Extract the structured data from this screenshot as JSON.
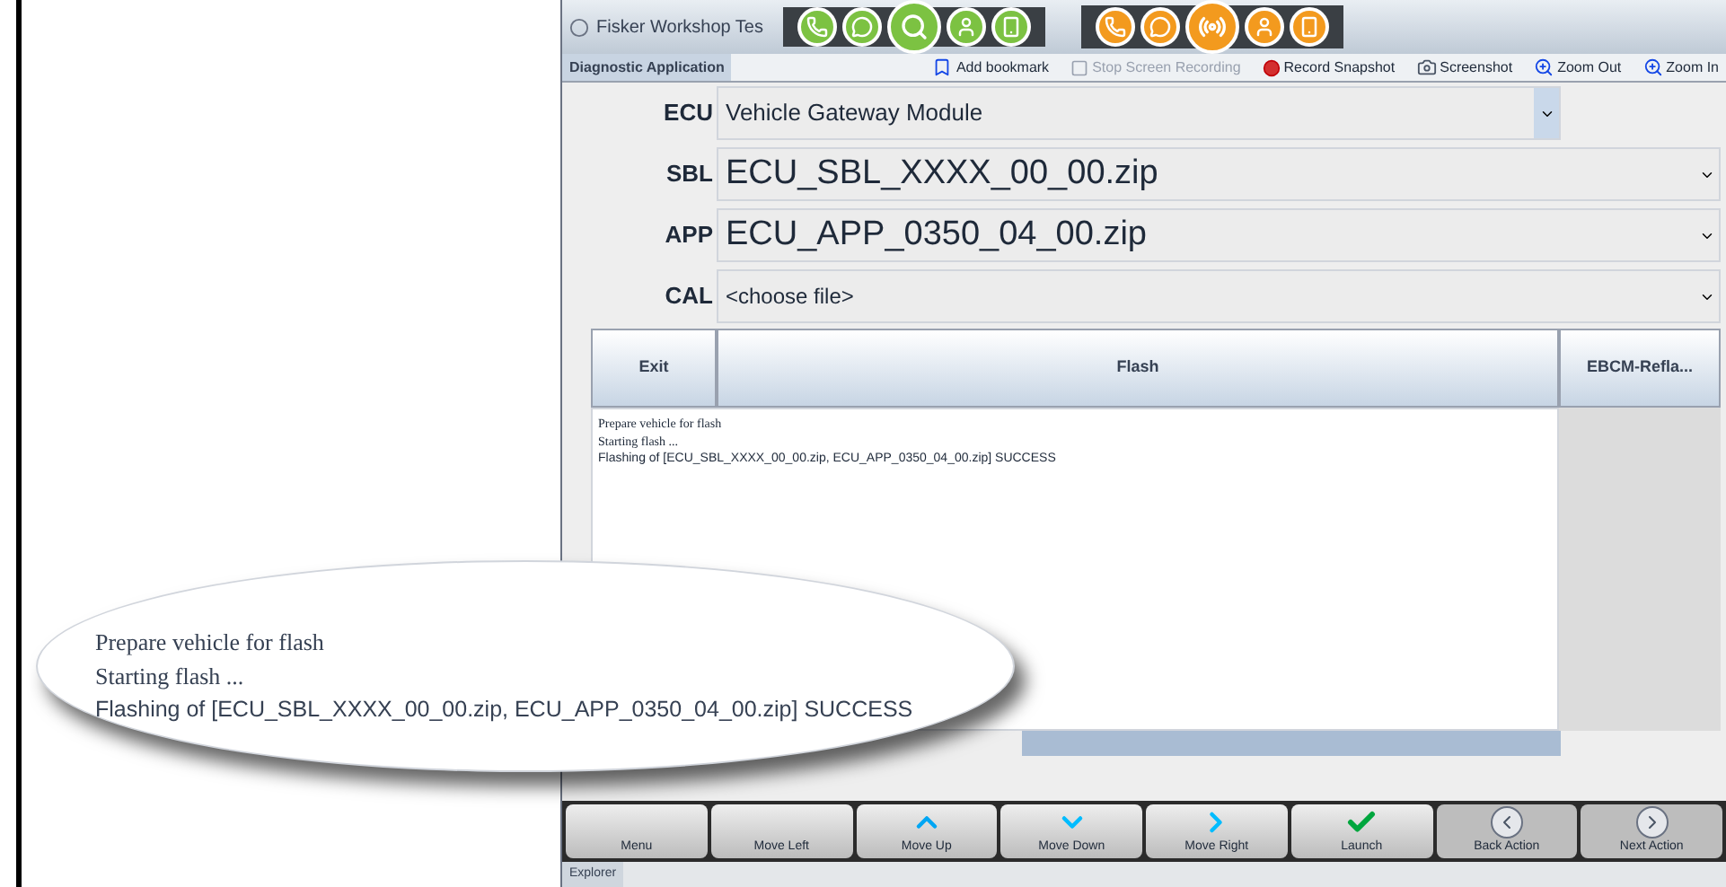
{
  "window": {
    "title": "Fisker Workshop Tes"
  },
  "toolbar": {
    "tab": "Diagnostic Application",
    "actions": [
      {
        "label": "Add bookmark",
        "kind": "bookmark",
        "disabled": false
      },
      {
        "label": "Stop Screen Recording",
        "kind": "stop",
        "disabled": true
      },
      {
        "label": "Record Snapshot",
        "kind": "record",
        "disabled": false
      },
      {
        "label": "Screenshot",
        "kind": "camera",
        "disabled": false
      },
      {
        "label": "Zoom Out",
        "kind": "zoom",
        "disabled": false
      },
      {
        "label": "Zoom In",
        "kind": "zoom",
        "disabled": false
      }
    ]
  },
  "form": {
    "fields": [
      {
        "label": "ECU",
        "value": "Vehicle Gateway Module",
        "kind": "select"
      },
      {
        "label": "SBL",
        "value": "ECU_SBL_XXXX_00_00.zip",
        "kind": "file"
      },
      {
        "label": "APP",
        "value": "ECU_APP_0350_04_00.zip",
        "kind": "file"
      },
      {
        "label": "CAL",
        "value": "<choose file>",
        "kind": "file_small"
      }
    ]
  },
  "buttons": [
    "Exit",
    "Flash",
    "EBCM-Refla..."
  ],
  "log": [
    "Prepare vehicle for flash",
    "Starting flash ...",
    "Flashing of [ECU_SBL_XXXX_00_00.zip, ECU_APP_0350_04_00.zip] SUCCESS"
  ],
  "magnifier": {
    "lines": [
      "Prepare vehicle for flash",
      "Starting flash ...",
      "Flashing of [ECU_SBL_XXXX_00_00.zip, ECU_APP_0350_04_00.zip] SUCCESS"
    ]
  },
  "nav_buttons": [
    {
      "label": "Menu",
      "kind": "none"
    },
    {
      "label": "Move Left",
      "kind": "none"
    },
    {
      "label": "Move Up",
      "kind": "up"
    },
    {
      "label": "Move Down",
      "kind": "down"
    },
    {
      "label": "Move Right",
      "kind": "right"
    },
    {
      "label": "Launch",
      "kind": "check"
    },
    {
      "label": "Back Action",
      "kind": "back"
    },
    {
      "label": "Next Action",
      "kind": "next"
    }
  ],
  "status_bar": {
    "tab": "Explorer"
  }
}
